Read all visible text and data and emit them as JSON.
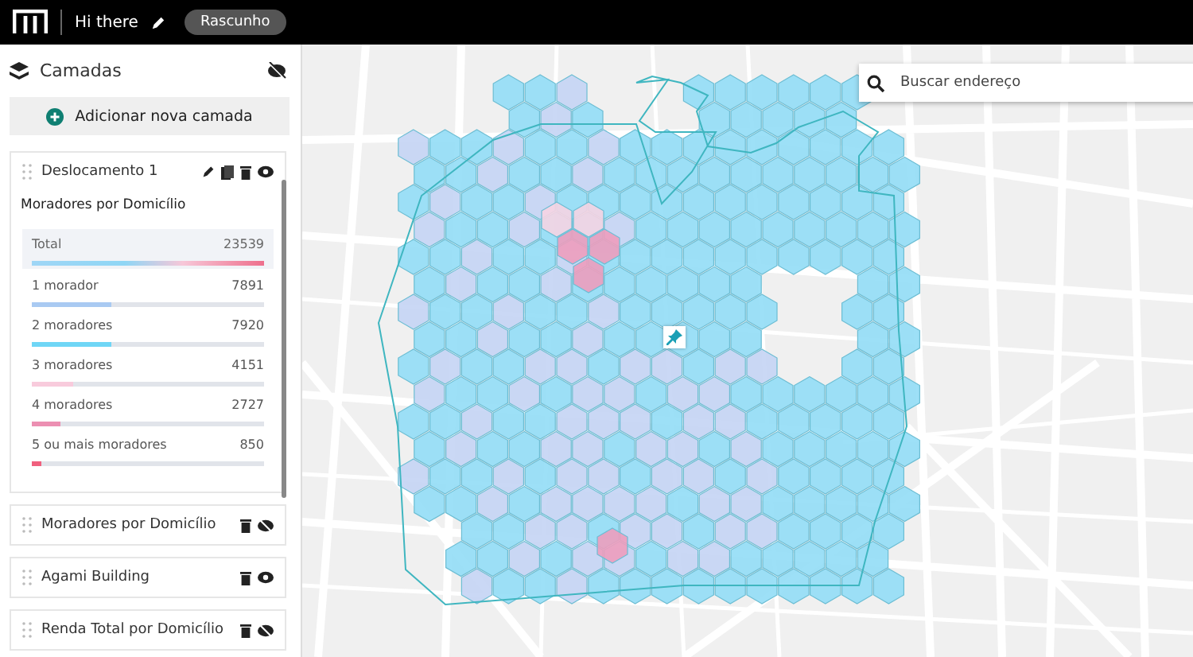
{
  "header": {
    "title": "Hi there",
    "badge": "Rascunho"
  },
  "sidebar": {
    "title": "Camadas",
    "add_button": "Adicionar nova camada"
  },
  "layers": [
    {
      "name": "Deslocamento 1",
      "expanded": true,
      "visible": true,
      "subtitle": "Moradores por Domicílio",
      "legend": [
        {
          "kind": "total",
          "label": "Total",
          "value": "23539",
          "level": 1
        },
        {
          "kind": "category",
          "label": "1 morador",
          "value": "7891",
          "level": 0.34,
          "color": "#a9caf2"
        },
        {
          "kind": "category",
          "label": "2 moradores",
          "value": "7920",
          "level": 0.34,
          "color": "#6fd6f6"
        },
        {
          "kind": "category",
          "label": "3 moradores",
          "value": "4151",
          "level": 0.18,
          "color": "#f8cbdc"
        },
        {
          "kind": "category",
          "label": "4 moradores",
          "value": "2727",
          "level": 0.12,
          "color": "#ec8fb2"
        },
        {
          "kind": "category",
          "label": "5 ou mais moradores",
          "value": "850",
          "level": 0.04,
          "color": "#f0607e"
        }
      ]
    },
    {
      "name": "Moradores por Domicílio",
      "expanded": false,
      "visible": false
    },
    {
      "name": "Agami Building",
      "expanded": false,
      "visible": true
    },
    {
      "name": "Renda Total por Domicílio",
      "expanded": false,
      "visible": false
    }
  ],
  "map": {
    "search": {
      "placeholder": "Buscar endereço"
    }
  }
}
